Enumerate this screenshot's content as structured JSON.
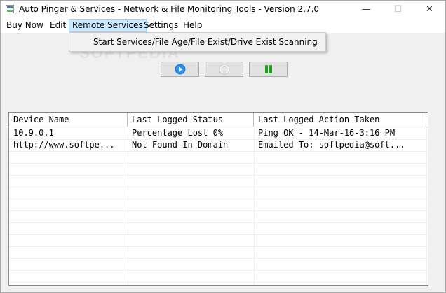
{
  "window": {
    "title": "Auto Pinger & Services - Network & File Monitoring Tools - Version 2.7.0",
    "minimize_glyph": "—",
    "maximize_glyph": "☐",
    "close_glyph": "✕"
  },
  "menu": {
    "items": [
      {
        "label": "Buy Now"
      },
      {
        "label": "Edit"
      },
      {
        "label": "Remote Services"
      },
      {
        "label": "Settings"
      },
      {
        "label": "Help"
      }
    ],
    "open_dropdown": {
      "items": [
        {
          "label": "Start Services/File Age/File Exist/Drive Exist Scanning"
        }
      ]
    }
  },
  "toolbar": {
    "buttons": [
      {
        "icon": "play-icon",
        "color": "#1e7fd8",
        "enabled": true
      },
      {
        "icon": "stop-icon",
        "color": "#c8c8c8",
        "enabled": false
      },
      {
        "icon": "pause-icon",
        "color": "#20a020",
        "enabled": true
      }
    ]
  },
  "table": {
    "columns": [
      "Device Name",
      "Last Logged Status",
      "Last Logged Action Taken"
    ],
    "rows": [
      [
        "10.9.0.1",
        "Percentage Lost 0%",
        "Ping OK - 14-Mar-16-3:16 PM"
      ],
      [
        "http://www.softpe...",
        "Not Found In Domain",
        "Emailed To: softpedia@soft..."
      ]
    ]
  },
  "watermark": "SOFTPEDIA"
}
